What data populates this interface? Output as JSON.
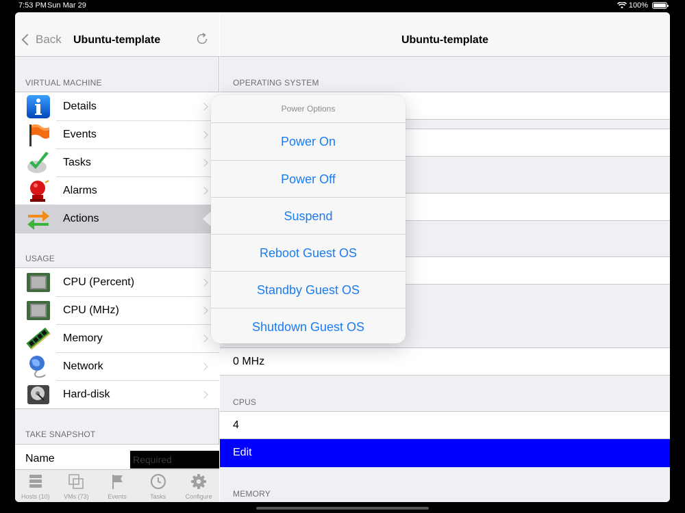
{
  "status_bar": {
    "time": "7:53 PM",
    "date": "Sun Mar 29",
    "battery": "100%"
  },
  "left": {
    "back_label": "Back",
    "title": "Ubuntu-template",
    "sections": {
      "virtual_machine": "VIRTUAL MACHINE",
      "usage": "USAGE",
      "take_snapshot": "TAKE SNAPSHOT"
    },
    "vm_items": [
      {
        "label": "Details",
        "icon": "info-icon"
      },
      {
        "label": "Events",
        "icon": "flag-icon"
      },
      {
        "label": "Tasks",
        "icon": "checkmark-icon"
      },
      {
        "label": "Alarms",
        "icon": "alarm-bell-icon"
      },
      {
        "label": "Actions",
        "icon": "actions-arrows-icon",
        "selected": true
      }
    ],
    "usage_items": [
      {
        "label": "CPU (Percent)",
        "icon": "cpu-chip-icon"
      },
      {
        "label": "CPU (MHz)",
        "icon": "cpu-chip-icon"
      },
      {
        "label": "Memory",
        "icon": "memory-stick-icon"
      },
      {
        "label": "Network",
        "icon": "network-globe-icon"
      },
      {
        "label": "Hard-disk",
        "icon": "hard-disk-icon"
      }
    ],
    "snapshot": {
      "name_label": "Name",
      "name_placeholder": "Required",
      "name_value": ""
    },
    "tabs": [
      {
        "label": "Hosts (10)",
        "icon": "hosts-server-icon"
      },
      {
        "label": "VMs (73)",
        "icon": "vms-icon"
      },
      {
        "label": "Events",
        "icon": "flag-tab-icon"
      },
      {
        "label": "Tasks",
        "icon": "clock-icon"
      },
      {
        "label": "Configure",
        "icon": "gear-icon"
      }
    ]
  },
  "right": {
    "title": "Ubuntu-template",
    "sections": {
      "operating_system": "OPERATING SYSTEM",
      "cpus": "CPUS",
      "memory": "MEMORY"
    },
    "cpu_mhz_value": "0 MHz",
    "cpus_value": "4",
    "edit_label": "Edit"
  },
  "popover": {
    "title": "Power Options",
    "items": [
      "Power On",
      "Power Off",
      "Suspend",
      "Reboot Guest OS",
      "Standby Guest OS",
      "Shutdown Guest OS"
    ]
  },
  "colors": {
    "accent": "#1a7cf3",
    "edit_highlight": "#0000ff",
    "selected_row": "#d1d1d6"
  }
}
